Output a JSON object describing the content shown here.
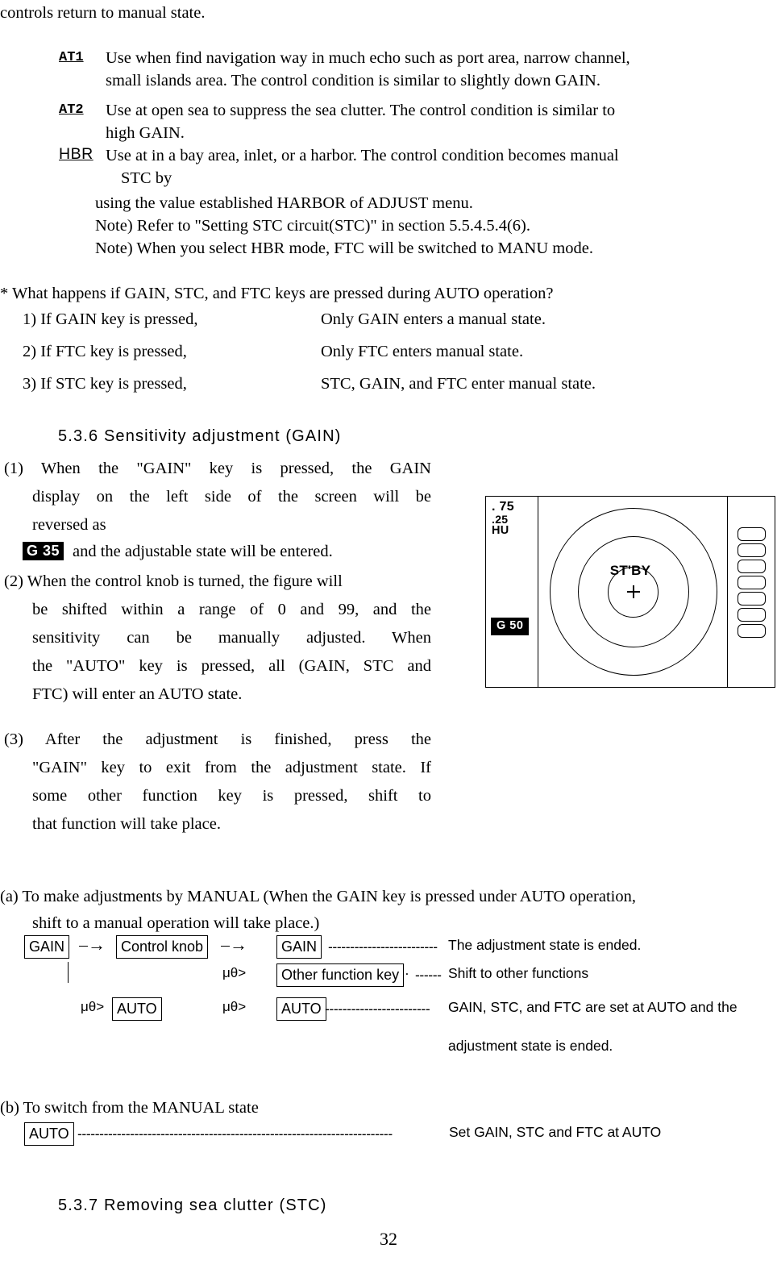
{
  "document": {
    "page_number": "32"
  },
  "intro": {
    "line": "controls return to manual state."
  },
  "definitions": [
    {
      "tag": "AT1",
      "lines": [
        "Use when find navigation way in much echo such as port area, narrow channel,",
        "small islands area. The control condition is similar to slightly down GAIN."
      ]
    },
    {
      "tag": "AT2",
      "lines": [
        "Use at open sea to suppress the sea clutter. The control condition is similar to",
        "high  GAIN."
      ]
    },
    {
      "tag": "HBR",
      "lines": [
        "Use at in a bay area, inlet, or a harbor. The control condition becomes manual",
        "STC by",
        "using the value established HARBOR of ADJUST menu.",
        "Note) Refer to \"Setting STC circuit(STC)\" in section 5.5.4.5.4(6).",
        "Note) When you select HBR mode, FTC will be switched to MANU mode."
      ]
    }
  ],
  "question_block": {
    "prompt": "* What happens if GAIN, STC, and FTC keys are pressed during AUTO operation?",
    "rows": [
      {
        "num": "1)  If GAIN key is pressed,",
        "answer": "Only GAIN enters a manual state."
      },
      {
        "num": "2)  If FTC key is pressed,",
        "answer": "Only FTC enters manual state."
      },
      {
        "num": "3)  If STC key is pressed,",
        "answer": "STC, GAIN, and FTC enter manual state."
      }
    ]
  },
  "section_536": {
    "heading": "5.3.6 Sensitivity adjustment (GAIN)",
    "item1": {
      "lines": [
        "(1)   When  the  \"GAIN\"  key  is  pressed,  the  GAIN",
        "display  on  the  left  side  of  the  screen  will  be",
        "reversed as"
      ],
      "badge": "G 35",
      "badge_tail": "and the adjustable state will be entered."
    },
    "item2": {
      "lines": [
        "(2)  When the control knob is turned, the figure will",
        "be shifted within a range of  0 and 99,  and  the",
        "sensitivity  can  be  manually  adjusted.    When",
        "the  \"AUTO\"  key  is  pressed,  all  (GAIN,  STC  and",
        "FTC) will enter an AUTO state."
      ]
    },
    "item3": {
      "lines": [
        "(3)   After  the  adjustment  is  finished,  press  the",
        "\"GAIN\" key to exit from the adjustment state.  If",
        "some  other  function  key  is  pressed,  shift  to",
        "that function will take place."
      ]
    }
  },
  "radar_display": {
    "range_labels": [
      ". 75",
      ".25",
      "HU"
    ],
    "gain_badge": "G  50",
    "mode_label": "ST'BY",
    "center_marker": "+",
    "softkey_count": 7
  },
  "manual_section_a": {
    "lines": [
      "(a)  To make adjustments by MANUAL (When the GAIN key is pressed under AUTO operation,",
      "shift to a manual operation will take place.)"
    ],
    "flow": {
      "row1": {
        "box_start": "GAIN",
        "arrow1": "⎯→",
        "box_mid": "Control knob",
        "arrow2": "⎯→",
        "box_end": "GAIN",
        "leader": "-------------------------",
        "note": "The adjustment state is ended."
      },
      "row2": {
        "connector": "μθ>",
        "box_end": "Other function key",
        "bullet": "·",
        "leader": "------",
        "note": "Shift to other functions"
      },
      "row3": {
        "connector_left": "μθ>",
        "box_left": "AUTO",
        "connector_right": "μθ>",
        "box_end": "AUTO",
        "leader": "------------------------",
        "note": "GAIN, STC, and FTC are set at AUTO and the",
        "note_line2": "adjustment state is ended."
      }
    }
  },
  "manual_section_b": {
    "title": "(b)  To switch from the MANUAL state",
    "box": "AUTO",
    "leader": "------------------------------------------------------------------------",
    "note": "Set GAIN, STC and FTC at AUTO"
  },
  "section_537": {
    "heading": "5.3.7 Removing sea clutter (STC)"
  }
}
